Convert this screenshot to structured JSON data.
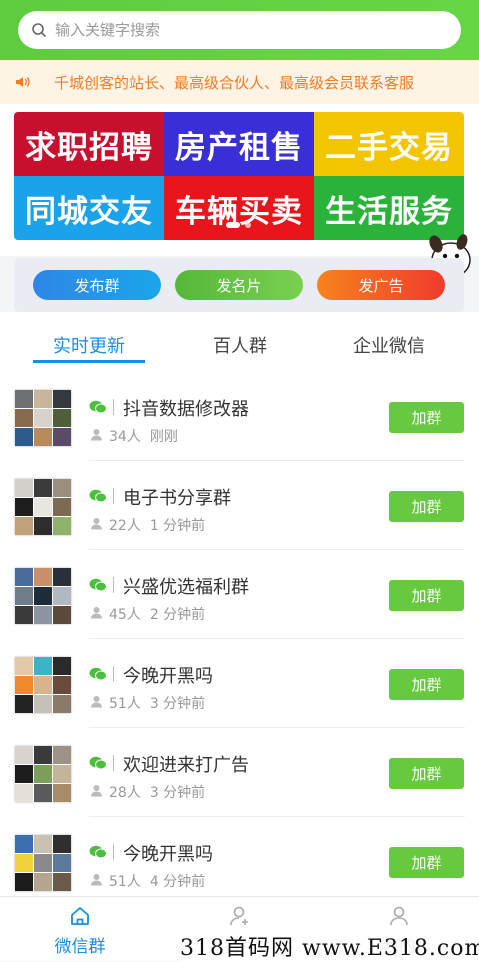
{
  "search": {
    "placeholder": "输入关键字搜索"
  },
  "notice": {
    "text": "千城创客的站长、最高级合伙人、最高级会员联系客服"
  },
  "banner": {
    "tiles": [
      {
        "label": "求职招聘",
        "bg": "#c8102e"
      },
      {
        "label": "房产租售",
        "bg": "#3a2fd6"
      },
      {
        "label": "二手交易",
        "bg": "#f2c500"
      },
      {
        "label": "同城交友",
        "bg": "#1aa3ea"
      },
      {
        "label": "车辆买卖",
        "bg": "#e8161c"
      },
      {
        "label": "生活服务",
        "bg": "#2bb23a"
      }
    ]
  },
  "actions": {
    "publish_group": "发布群",
    "publish_card": "发名片",
    "publish_ad": "发广告"
  },
  "tabs": [
    "实时更新",
    "百人群",
    "企业微信"
  ],
  "groups": [
    {
      "name": "抖音数据修改器",
      "members": "34人",
      "time": "刚刚"
    },
    {
      "name": "电子书分享群",
      "members": "22人",
      "time": "1 分钟前"
    },
    {
      "name": "兴盛优选福利群",
      "members": "45人",
      "time": "2 分钟前"
    },
    {
      "name": "今晚开黑吗",
      "members": "51人",
      "time": "3 分钟前"
    },
    {
      "name": "欢迎进来打广告",
      "members": "28人",
      "time": "3 分钟前"
    },
    {
      "name": "今晚开黑吗",
      "members": "51人",
      "time": "4 分钟前"
    }
  ],
  "join_label": "加群",
  "tabbar": [
    "微信群",
    "名片",
    "我的"
  ],
  "watermark": "318首码网 www.E318.com",
  "colors": {
    "accent": "#1a8ee3",
    "green": "#66c93f",
    "notice": "#f47c21"
  }
}
